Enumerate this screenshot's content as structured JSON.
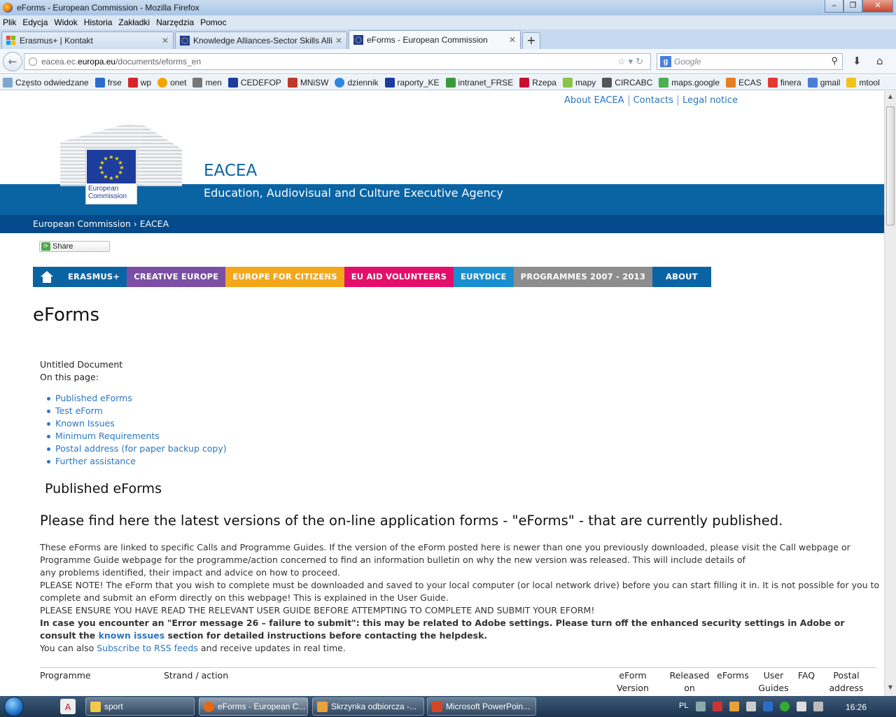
{
  "window": {
    "title": "eForms - European Commission - Mozilla Firefox",
    "minimize": "‒",
    "maximize": "❐",
    "close": "✕"
  },
  "menu": [
    "Plik",
    "Edycja",
    "Widok",
    "Historia",
    "Zakładki",
    "Narzędzia",
    "Pomoc"
  ],
  "tabs": [
    {
      "label": "Erasmus+ | Kontakt",
      "active": false
    },
    {
      "label": "Knowledge Alliances-Sector Skills Alli...",
      "active": false
    },
    {
      "label": "eForms - European Commission",
      "active": true
    }
  ],
  "address": {
    "prefix": "eacea.ec.",
    "domain": "europa.eu",
    "path": "/documents/eforms_en"
  },
  "search": {
    "placeholder": "Google"
  },
  "bookmarks": [
    "Często odwiedzane",
    "frse",
    "wp",
    "onet",
    "men",
    "CEDEFOP",
    "MNiSW",
    "dziennik",
    "raporty_KE",
    "intranet_FRSE",
    "Rzepa",
    "mapy",
    "CIRCABC",
    "maps.google",
    "ECAS",
    "finera",
    "gmail",
    "mtool"
  ],
  "page": {
    "toplinks": [
      "About EACEA",
      "Contacts",
      "Legal notice"
    ],
    "logo_text": "European Commission",
    "agency_short": "EACEA",
    "agency_long": "Education, Audiovisual and Culture Executive Agency",
    "breadcrumb": "European Commission › EACEA",
    "share": "Share",
    "nav": [
      {
        "label": "ERASMUS+",
        "color": "#0a64a4"
      },
      {
        "label": "CREATIVE EUROPE",
        "color": "#7b4fa3"
      },
      {
        "label": "EUROPE FOR CITIZENS",
        "color": "#f3a81b"
      },
      {
        "label": "EU AID VOLUNTEERS",
        "color": "#e30f6a"
      },
      {
        "label": "EURYDICE",
        "color": "#1a8fd0"
      },
      {
        "label": "PROGRAMMES 2007 - 2013",
        "color": "#8d8d8d"
      },
      {
        "label": "ABOUT",
        "color": "#0a64a4"
      }
    ],
    "title": "eForms",
    "untitled": "Untitled Document",
    "on_this_page": "On this page:",
    "toc": [
      "Published eForms",
      "Test eForm",
      "Known Issues",
      "Minimum Requirements",
      "Postal address (for paper backup copy)",
      "Further assistance"
    ],
    "section_title": "Published eForms",
    "lead": "Please find here the latest versions of the on-line application forms - \"eForms\" - that are currently published.",
    "p1": "These eForms are linked to specific Calls and Programme Guides. If the version of the eForm posted here is newer than one you previously downloaded, please visit the Call webpage or Programme Guide webpage for the programme/action concerned to find an information bulletin on why the new version was released. This will include details of",
    "p1b": "any problems identified, their impact and advice on how to proceed.",
    "p2": "PLEASE NOTE! The eForm that you wish to complete must be downloaded and saved to your local computer (or local network drive) before you can start filling it in. It is not possible for you to complete and submit an eForm directly on this webpage! This is explained in the User Guide.",
    "p3": "PLEASE ENSURE YOU HAVE READ THE RELEVANT USER GUIDE BEFORE ATTEMPTING TO COMPLETE AND SUBMIT YOUR EFORM!",
    "p4_pre": "In case you encounter an \"Error message 26 – failure to submit\": this may be related to Adobe settings. Please turn off the enhanced security settings in Adobe or consult the ",
    "p4_link": "known issues",
    "p4_post": " section for detailed instructions before contacting the helpdesk.",
    "p5_pre": "You can also ",
    "p5_link": "Subscribe to RSS feeds",
    "p5_post": " and receive updates in real time.",
    "table_headers": {
      "programme": "Programme",
      "strand": "Strand / action",
      "version": "eForm Version",
      "released": "Released on",
      "eforms": "eForms",
      "guides": "User Guides",
      "faq": "FAQ",
      "postal": "Postal address"
    }
  },
  "taskbar": {
    "items": [
      "sport",
      "eForms - European C...",
      "Skrzynka odbiorcza -...",
      "Microsoft PowerPoin..."
    ],
    "language": "PL",
    "clock": "16:26"
  }
}
